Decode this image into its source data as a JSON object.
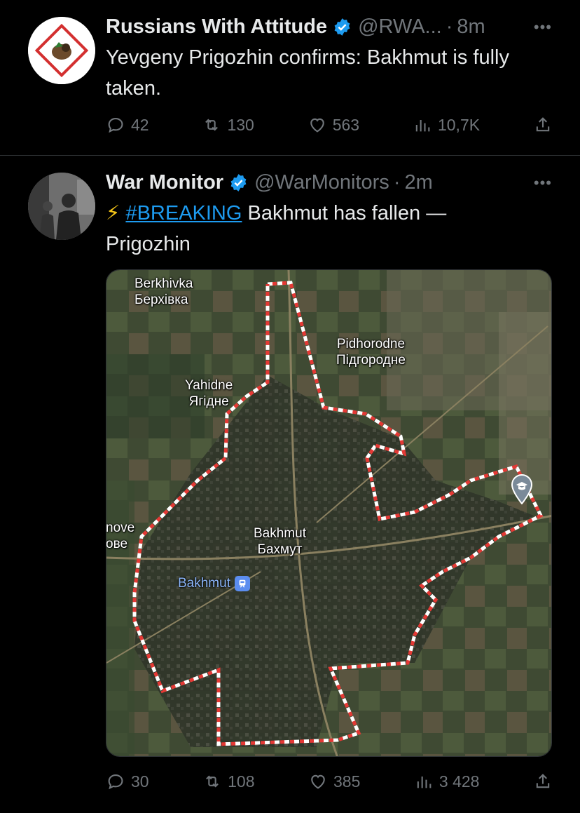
{
  "tweets": [
    {
      "name": "Russians With Attitude",
      "handle": "@RWA...",
      "sep": "·",
      "time": "8m",
      "text": "Yevgeny Prigozhin confirms: Bakhmut is fully taken.",
      "stats": {
        "replies": "42",
        "reposts": "130",
        "likes": "563",
        "views": "10,7K"
      }
    },
    {
      "name": "War Monitor",
      "handle": "@WarMonitors",
      "sep": "·",
      "time": "2m",
      "emoji": "⚡",
      "hashtag": "#BREAKING",
      "text": " Bakhmut has fallen — Prigozhin",
      "map": {
        "labels": {
          "berkhivka_en": "Berkhivka",
          "berkhivka_uk": "Берхівка",
          "pidhorodne_en": "Pidhorodne",
          "pidhorodne_uk": "Підгородне",
          "yahidne_en": "Yahidne",
          "yahidne_uk": "Ягідне",
          "bakhmut_en": "Bakhmut",
          "bakhmut_uk": "Бахмут",
          "left_en": "nove",
          "left_uk": "ове",
          "station": "Bakhmut"
        }
      },
      "stats": {
        "replies": "30",
        "reposts": "108",
        "likes": "385",
        "views": "3 428"
      }
    }
  ],
  "colors": {
    "background": "#000000",
    "text": "#e7e9ea",
    "muted": "#71767b",
    "accent": "#1d9bf0",
    "border": "#2f3336"
  },
  "icons": [
    "verified-badge-icon",
    "more-icon",
    "reply-icon",
    "repost-icon",
    "like-icon",
    "views-icon",
    "share-icon",
    "train-station-icon",
    "map-pin-icon"
  ]
}
